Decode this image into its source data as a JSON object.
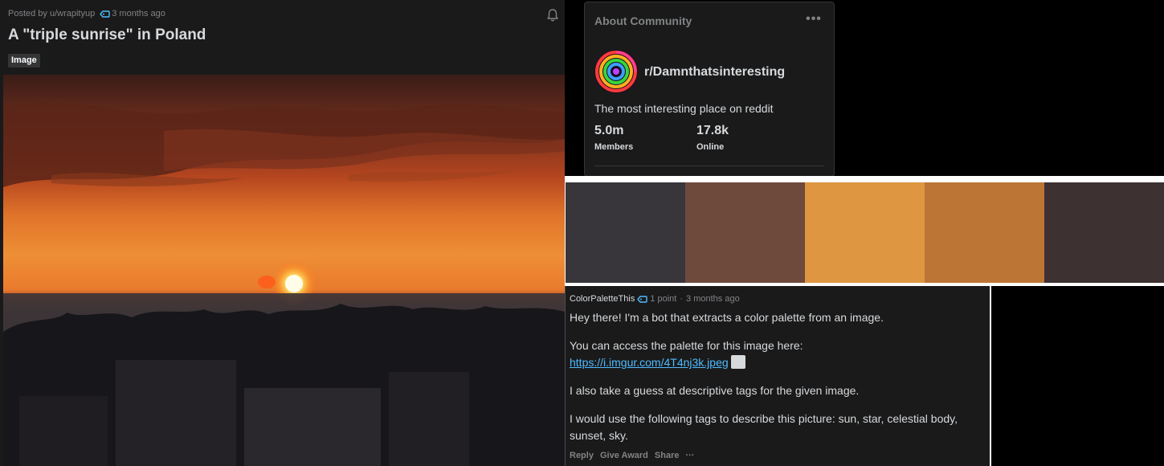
{
  "post": {
    "posted_by": "Posted by u/wrapityup",
    "time_ago": "3 months ago",
    "title": "A \"triple sunrise\" in Poland",
    "flair": "Image"
  },
  "about": {
    "heading": "About Community",
    "name": "r/Damnthatsinteresting",
    "description": "The most interesting place on reddit",
    "members_value": "5.0m",
    "members_label": "Members",
    "online_value": "17.8k",
    "online_label": "Online"
  },
  "palette": {
    "colors": [
      "#38363a",
      "#6e4a3c",
      "#de9640",
      "#bd7536",
      "#3d3132"
    ]
  },
  "comment": {
    "author": "ColorPaletteThis",
    "points": "1 point",
    "separator": "·",
    "time_ago": "3 months ago",
    "para1": "Hey there! I'm a bot that extracts a color palette from an image.",
    "para2": "You can access the palette for this image here:",
    "link": "https://i.imgur.com/4T4nj3k.jpeg",
    "para3": "I also take a guess at descriptive tags for the given image.",
    "para4": "I would use the following tags to describe this picture: sun, star, celestial body, sunset, sky.",
    "reply": "Reply",
    "give_award": "Give Award",
    "share": "Share",
    "more": "···"
  },
  "colors": {
    "page_bg": "#000000",
    "card_bg": "#1a1a1b",
    "text": "#d7dadc",
    "muted": "#818384",
    "link": "#4fbcff"
  }
}
